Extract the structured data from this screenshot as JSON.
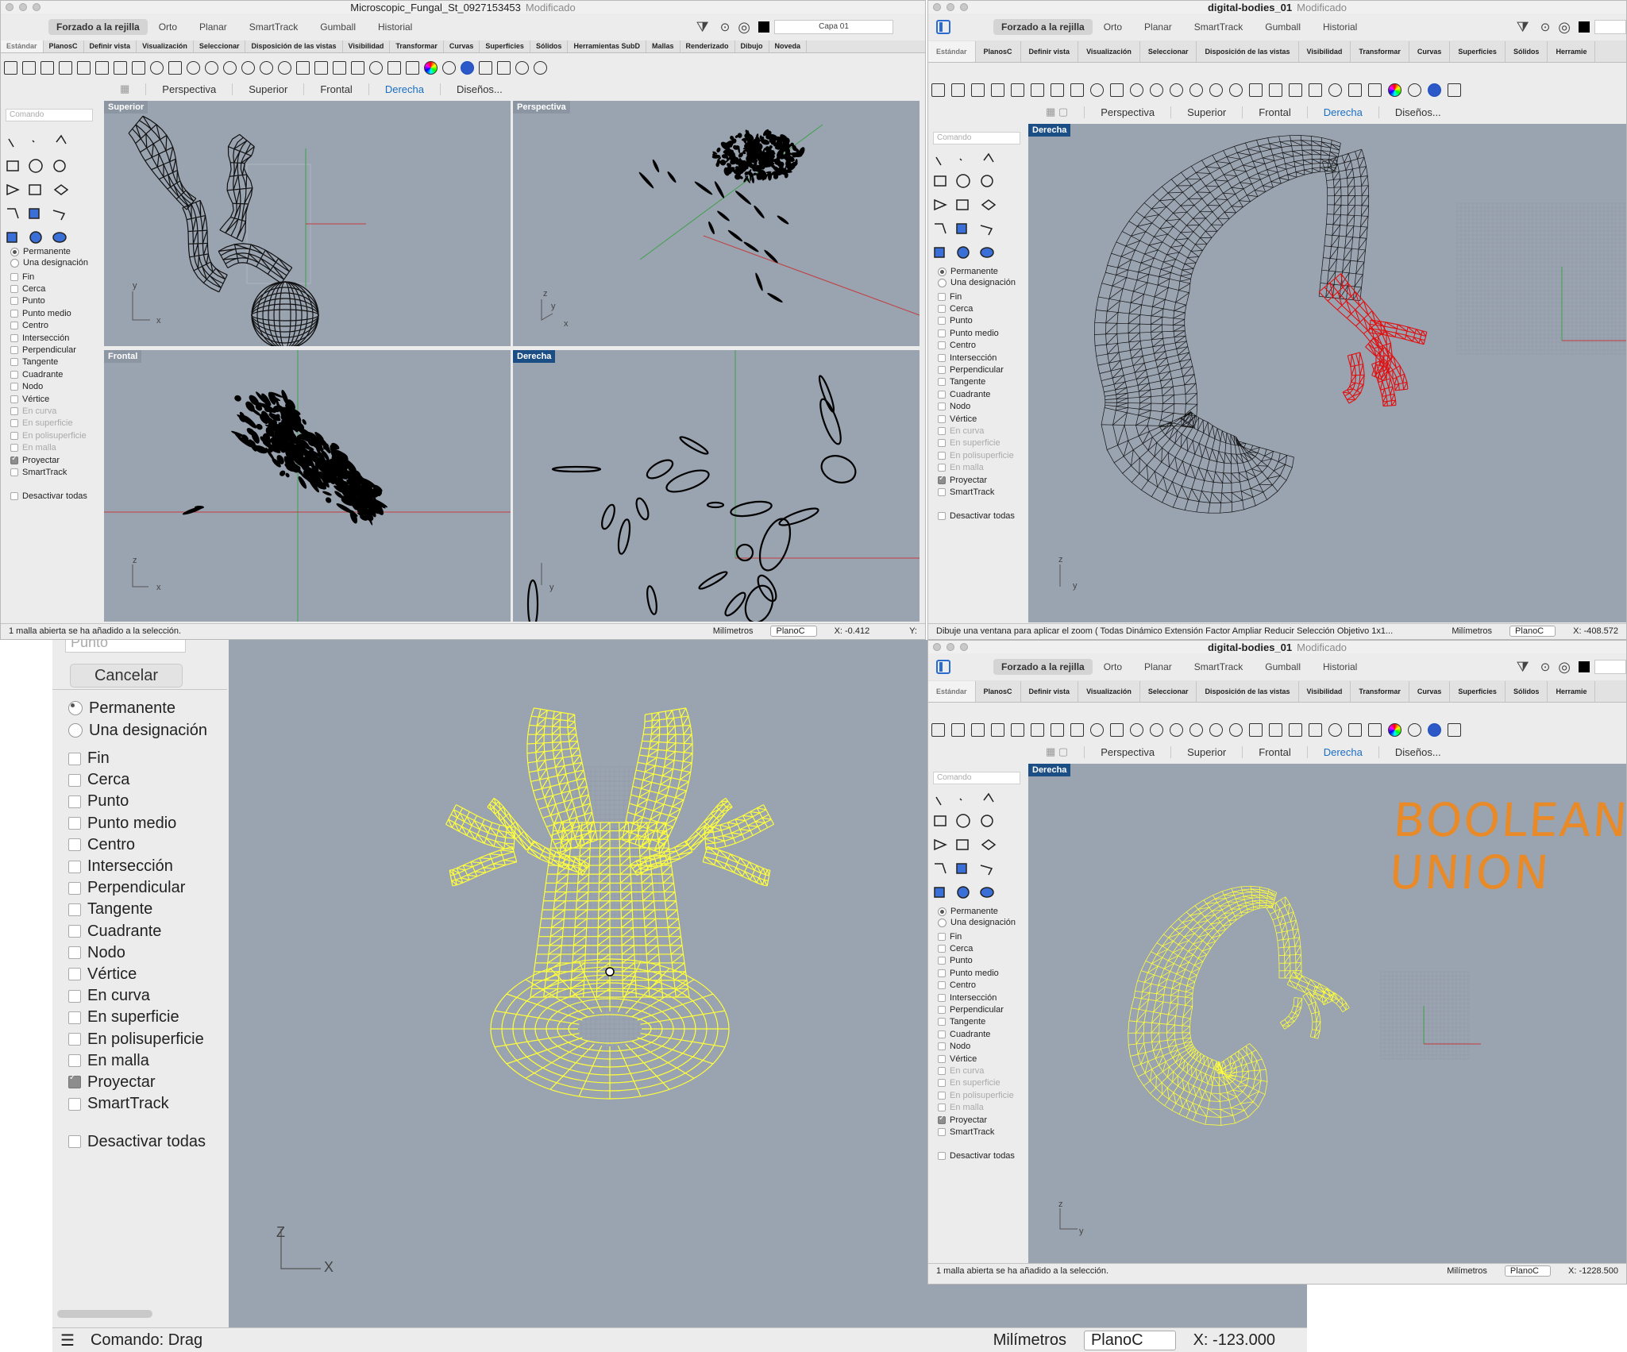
{
  "top_left": {
    "title": "Microscopic_Fungal_St_0927153453",
    "modified": "Modificado",
    "menu": [
      "Forzado a la rejilla",
      "Orto",
      "Planar",
      "SmartTrack",
      "Gumball",
      "Historial"
    ],
    "layer": "Capa 01",
    "tabs": [
      "Estándar",
      "PlanosC",
      "Definir vista",
      "Visualización",
      "Seleccionar",
      "Disposición de las vistas",
      "Visibilidad",
      "Transformar",
      "Curvas",
      "Superficies",
      "Sólidos",
      "Herramientas SubD",
      "Mallas",
      "Renderizado",
      "Dibujo",
      "Noveda"
    ],
    "viewtabs": [
      "Perspectiva",
      "Superior",
      "Frontal",
      "Derecha",
      "Diseños..."
    ],
    "active_viewtab": "Derecha",
    "command_placeholder": "Comando",
    "viewports": [
      "Superior",
      "Perspectiva",
      "Frontal",
      "Derecha"
    ],
    "status_msg": "1 malla abierta se ha añadido a la selección.",
    "units": "Milímetros",
    "cplane": "PlanoC",
    "x_coord": "X: -0.412",
    "y_coord": "Y:"
  },
  "osnaps": {
    "permanent": "Permanente",
    "once": "Una designación",
    "items": [
      "Fin",
      "Cerca",
      "Punto",
      "Punto medio",
      "Centro",
      "Intersección",
      "Perpendicular",
      "Tangente",
      "Cuadrante",
      "Nodo",
      "Vértice",
      "En curva",
      "En superficie",
      "En polisuperficie",
      "En malla",
      "Proyectar",
      "SmartTrack"
    ],
    "disable": "Desactivar todas"
  },
  "top_right": {
    "title": "digital-bodies_01",
    "modified": "Modificado",
    "menu": [
      "Forzado a la rejilla",
      "Orto",
      "Planar",
      "SmartTrack",
      "Gumball",
      "Historial"
    ],
    "tabs": [
      "Estándar",
      "PlanosC",
      "Definir vista",
      "Visualización",
      "Seleccionar",
      "Disposición de las vistas",
      "Visibilidad",
      "Transformar",
      "Curvas",
      "Superficies",
      "Sólidos",
      "Herramie"
    ],
    "viewtabs": [
      "Perspectiva",
      "Superior",
      "Frontal",
      "Derecha",
      "Diseños..."
    ],
    "command_placeholder": "Comando",
    "viewport": "Derecha",
    "status_msg": "Dibuje una ventana para aplicar el zoom ( Todas Dinámico Extensión Factor Ampliar Reducir Selección Objetivo 1x1...",
    "units": "Milímetros",
    "cplane": "PlanoC",
    "x_coord": "X: -408.572"
  },
  "bottom_left": {
    "input_text": "Punto",
    "cancel": "Cancelar",
    "command_text": "Comando: Drag",
    "units": "Milímetros",
    "cplane": "PlanoC",
    "x_coord": "X: -123.000",
    "axis_z": "Z",
    "axis_x": "X"
  },
  "bottom_right": {
    "title": "digital-bodies_01",
    "modified": "Modificado",
    "menu": [
      "Forzado a la rejilla",
      "Orto",
      "Planar",
      "SmartTrack",
      "Gumball",
      "Historial"
    ],
    "tabs": [
      "Estándar",
      "PlanosC",
      "Definir vista",
      "Visualización",
      "Seleccionar",
      "Disposición de las vistas",
      "Visibilidad",
      "Transformar",
      "Curvas",
      "Superficies",
      "Sólidos",
      "Herramie"
    ],
    "viewtabs": [
      "Perspectiva",
      "Superior",
      "Frontal",
      "Derecha",
      "Diseños..."
    ],
    "command_placeholder": "Comando",
    "viewport": "Derecha",
    "annotation_line1": "BOOLEAN",
    "annotation_line2": "UNION",
    "status_msg": "1 malla abierta se ha añadido a la selección.",
    "units": "Milímetros",
    "cplane": "PlanoC",
    "x_coord": "X: -1228.500"
  },
  "colors": {
    "viewport_bg": "#9aa3b0",
    "mesh_black": "#111111",
    "mesh_red": "#e01010",
    "mesh_yellow": "#ffff3a",
    "annotation": "#e98a28",
    "active_label": "#1c4e86",
    "active_tab_text": "#1b6ec2"
  }
}
